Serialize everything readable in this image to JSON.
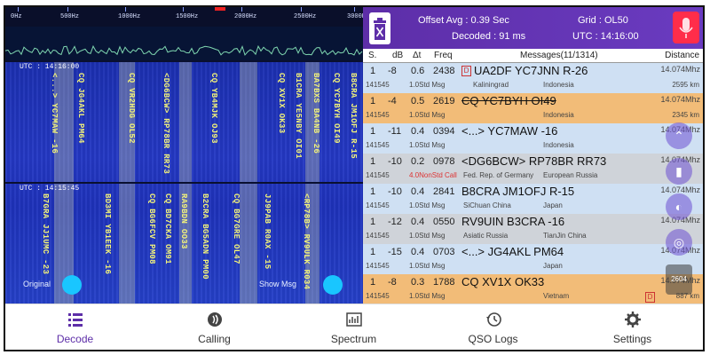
{
  "ruler": {
    "ticks": [
      "0Hz",
      "500Hz",
      "1000Hz",
      "1500Hz",
      "2000Hz",
      "2500Hz",
      "3000Hz"
    ]
  },
  "waterfall": {
    "utc_top": "UTC : 14:16:00",
    "utc_bottom": "UTC : 14:15:45",
    "top_decodes": [
      "<...> YC7MAW -16",
      "CQ JG4AKL PM64",
      "CQ VR2HDG OL52",
      "<DG6BCW> RP78BR RR73",
      "CQ YB4MJK OJ93",
      "CQ XV1X OK33",
      "B1CRA YE5NBY OI01",
      "BA7BXS BA4NB -26",
      "CQ YC7BYH OI49",
      "B8CRA JM1OFJ R-15"
    ],
    "bottom_decodes": [
      "B7GRA JJ1UMC -23",
      "BD3MI YB1EEK -16",
      "CQ BG6FCV PM08",
      "CQ BD7CKA OM91",
      "B2CRA BG5ADN PM00",
      "CQ BG7GRE OL47",
      "JJ9PAB R0AX -15",
      "<RP78B> RV9ULK R034",
      "RA9BDN OO33"
    ],
    "original_label": "Original",
    "showmsg_label": "Show Msg"
  },
  "header": {
    "offset": "Offset Avg : 0.39 Sec",
    "decoded": "Decoded : 91 ms",
    "grid": "Grid : OL50",
    "utc": "UTC : 14:16:00"
  },
  "columns": {
    "s": "S.",
    "db": "dB",
    "dt": "Δt",
    "freq": "Freq",
    "messages": "Messages(11/1314)",
    "distance": "Distance"
  },
  "rows": [
    {
      "s": "1",
      "db": "-8",
      "dt": "0.6",
      "freq": "2438",
      "msg": "UA2DF YC7JNN R-26",
      "band": "14.074Mhz",
      "time": "141545",
      "mode": "1.0Std Msg",
      "from": "Kaliningrad",
      "to": "Indonesia",
      "dist": "2595 km",
      "bg": "#cfe0f3",
      "strike": false,
      "flag_left": true,
      "flag_right": false,
      "mode_red": false
    },
    {
      "s": "1",
      "db": "-4",
      "dt": "0.5",
      "freq": "2619",
      "msg": "CQ YC7BYH OI49",
      "band": "14.074Mhz",
      "time": "141545",
      "mode": "1.0Std Msg",
      "from": "",
      "to": "Indonesia",
      "dist": "2345 km",
      "bg": "#f2bc78",
      "strike": true,
      "flag_left": false,
      "flag_right": false,
      "mode_red": false
    },
    {
      "s": "1",
      "db": "-11",
      "dt": "0.4",
      "freq": "0394",
      "msg": "<...> YC7MAW -16",
      "band": "14.074Mhz",
      "time": "141545",
      "mode": "1.0Std Msg",
      "from": "",
      "to": "Indonesia",
      "dist": "",
      "bg": "#cfe0f3",
      "strike": false,
      "flag_left": false,
      "flag_right": false,
      "mode_red": false
    },
    {
      "s": "1",
      "db": "-10",
      "dt": "0.2",
      "freq": "0978",
      "msg": "<DG6BCW> RP78BR RR73",
      "band": "14.074Mhz",
      "time": "141545",
      "mode": "4.0NonStd Call",
      "from": "Fed. Rep. of Germany",
      "to": "European Russia",
      "dist": "",
      "bg": "#cfd3d9",
      "strike": false,
      "flag_left": false,
      "flag_right": false,
      "mode_red": true
    },
    {
      "s": "1",
      "db": "-10",
      "dt": "0.4",
      "freq": "2841",
      "msg": "B8CRA JM1OFJ R-15",
      "band": "14.074Mhz",
      "time": "141545",
      "mode": "1.0Std Msg",
      "from": "SiChuan China",
      "to": "Japan",
      "dist": "",
      "bg": "#cfe0f3",
      "strike": false,
      "flag_left": false,
      "flag_right": false,
      "mode_red": false
    },
    {
      "s": "1",
      "db": "-12",
      "dt": "0.4",
      "freq": "0550",
      "msg": "RV9UIN B3CRA -16",
      "band": "14.074Mhz",
      "time": "141545",
      "mode": "1.0Std Msg",
      "from": "Asiatic Russia",
      "to": "TianJin China",
      "dist": "",
      "bg": "#cfd3d9",
      "strike": false,
      "flag_left": false,
      "flag_right": false,
      "mode_red": false
    },
    {
      "s": "1",
      "db": "-15",
      "dt": "0.4",
      "freq": "0703",
      "msg": "<...> JG4AKL PM64",
      "band": "14.074Mhz",
      "time": "141545",
      "mode": "1.0Std Msg",
      "from": "",
      "to": "Japan",
      "dist": "",
      "bg": "#cfe0f3",
      "strike": false,
      "flag_left": false,
      "flag_right": false,
      "mode_red": false
    },
    {
      "s": "1",
      "db": "-8",
      "dt": "0.3",
      "freq": "1788",
      "msg": "CQ XV1X OK33",
      "band": "14.074Mhz",
      "time": "141545",
      "mode": "1.0Std Msg",
      "from": "",
      "to": "Vietnam",
      "dist": "887 km",
      "bg": "#f2bc78",
      "strike": false,
      "flag_left": false,
      "flag_right": true,
      "mode_red": false
    }
  ],
  "fab": {
    "overlay_count": "2604"
  },
  "nav": [
    {
      "label": "Decode",
      "icon": "list-icon",
      "active": true
    },
    {
      "label": "Calling",
      "icon": "radio-icon",
      "active": false
    },
    {
      "label": "Spectrum",
      "icon": "spectrum-icon",
      "active": false
    },
    {
      "label": "QSO Logs",
      "icon": "history-icon",
      "active": false
    },
    {
      "label": "Settings",
      "icon": "gear-icon",
      "active": false
    }
  ],
  "colors": {
    "accent": "#5d2ea8",
    "mic": "#ff2d4a",
    "highlight": "#f2bc78",
    "row_blue": "#cfe0f3",
    "row_gray": "#cfd3d9"
  }
}
